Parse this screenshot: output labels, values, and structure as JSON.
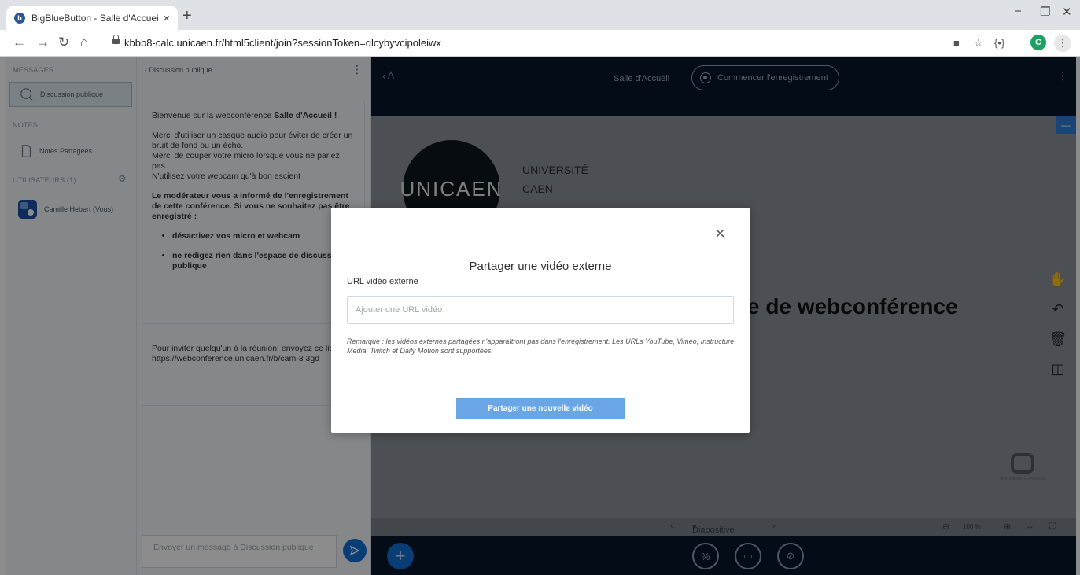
{
  "browser": {
    "tab_title": "BigBlueButton - Salle d'Accueil",
    "tab_close": "×",
    "new_tab": "+",
    "url": "kbbb8-calc.unicaen.fr/html5client/join?sessionToken=qlcybyvcipoleiwx",
    "profile_initial": "C",
    "window_minimize": "−",
    "window_maximize": "❐",
    "window_close": "✕"
  },
  "sidebar": {
    "messages_label": "MESSAGES",
    "public_chat": "Discussion publique",
    "notes_label": "NOTES",
    "shared_notes": "Notes Partagées",
    "users_label": "UTILISATEURS (1)",
    "user_name": "Camille Hebert (Vous)"
  },
  "chat": {
    "header": "Discussion publique",
    "welcome_prefix": "Bienvenue sur la webconférence",
    "welcome_room": "Salle d'Accueil !",
    "tips": [
      "Merci d'utiliser un casque audio pour éviter de créer un bruit de fond ou un écho.",
      "Merci de couper votre micro lorsque vous ne parlez pas.",
      "N'utilisez votre webcam qu'à bon escient !"
    ],
    "recording_notice": "Le modérateur vous a informé de l'enregistrement de cette conférence. Si vous ne souhaitez pas être enregistré :",
    "bullets": [
      "désactivez vos micro et webcam",
      "ne rédigez rien dans l'espace de discussion publique"
    ],
    "invite_text": "Pour inviter quelqu'un à la réunion, envoyez ce lien :",
    "invite_link": "https://webconference.unicaen.fr/b/cam-3 3gd",
    "input_placeholder": "Envoyer un message à Discussion publique"
  },
  "presentation": {
    "room_title": "Salle d'Accueil",
    "record_button": "Commencer l'enregistrement",
    "slide_logo": "UNICAEN",
    "slide_university": "UNIVERSITÉ",
    "slide_city": "CAEN",
    "slide_headline": "e de webconférence",
    "slide_label": "Diapositive 1",
    "zoom": "100 %",
    "brand_caption": "Normandie Université"
  },
  "modal": {
    "title": "Partager une vidéo externe",
    "url_label": "URL vidéo externe",
    "url_placeholder": "Ajouter une URL vidéo",
    "note": "Remarque : les vidéos externes partagées n'apparaîtront pas dans l'enregistrement. Les URLs YouTube, Vimeo, Instructure Media, Twitch et Daily Motion sont supportées.",
    "submit_label": "Partager une nouvelle vidéo",
    "close": "×"
  },
  "colors": {
    "dark_bg": "#06172a",
    "primary": "#0f70d7",
    "modal_button": "#6aa6e6",
    "panel_bg": "#f3f6f9"
  }
}
